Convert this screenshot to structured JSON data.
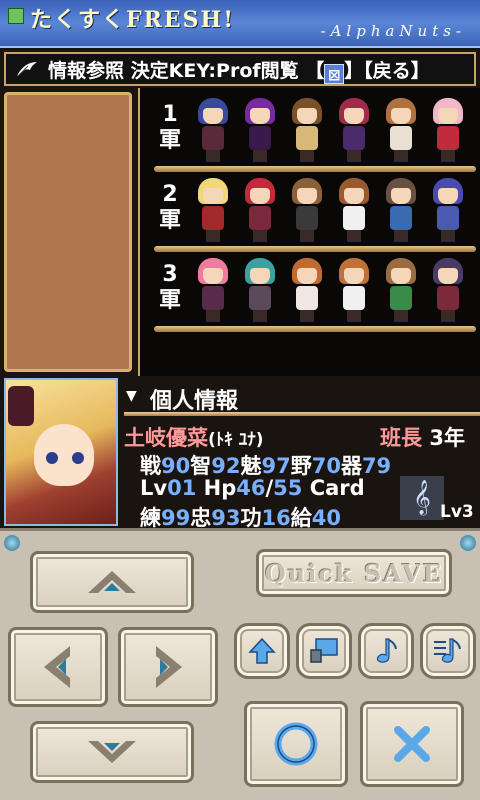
{
  "titlebar": {
    "title": "たくすくFRESH!",
    "subtitle": "-AlphaNuts-"
  },
  "header": {
    "text_prefix": "情報参照 決定KEY:Prof閲覧 【",
    "cancel_glyph": "⊠",
    "text_suffix": "】【戻る】"
  },
  "armies": [
    {
      "label": "1\n軍",
      "units": [
        {
          "hair": "#3a4a9a",
          "body": "#5a2a3a"
        },
        {
          "hair": "#7a2aa0",
          "body": "#3a1a4a"
        },
        {
          "hair": "#7a5028",
          "body": "#d8b878"
        },
        {
          "hair": "#a02a4a",
          "body": "#4a2a6a"
        },
        {
          "hair": "#b07040",
          "body": "#e8e0d0"
        },
        {
          "hair": "#f0b8c8",
          "body": "#c02a3a"
        }
      ]
    },
    {
      "label": "2\n軍",
      "units": [
        {
          "hair": "#f0d878",
          "body": "#a02a2a"
        },
        {
          "hair": "#c02a3a",
          "body": "#7a2a3a"
        },
        {
          "hair": "#8a6038",
          "body": "#3a3a3a"
        },
        {
          "hair": "#9a5a30",
          "body": "#f0f0f0"
        },
        {
          "hair": "#6a5040",
          "body": "#3a6ab0"
        },
        {
          "hair": "#4a4ab0",
          "body": "#4a5ab0"
        }
      ]
    },
    {
      "label": "3\n軍",
      "units": [
        {
          "hair": "#f07aa0",
          "body": "#5a2a4a"
        },
        {
          "hair": "#3aa0a0",
          "body": "#5a4a5a"
        },
        {
          "hair": "#c06a30",
          "body": "#f0e8e0"
        },
        {
          "hair": "#c07038",
          "body": "#f0f0f0"
        },
        {
          "hair": "#9a6a40",
          "body": "#3a8a4a"
        },
        {
          "hair": "#4a3a6a",
          "body": "#7a2a3a"
        }
      ]
    }
  ],
  "info": {
    "title": "個人情報",
    "name": "土岐優菜",
    "reading": "(ﾄｷ ﾕﾅ)",
    "role": "班長",
    "grade": "3",
    "grade_unit": "年",
    "stats1": [
      {
        "k": "戦",
        "v": "90"
      },
      {
        "k": "智",
        "v": "92"
      },
      {
        "k": "魅",
        "v": "97"
      },
      {
        "k": "野",
        "v": "70"
      },
      {
        "k": "器",
        "v": "79"
      }
    ],
    "lv_label": "Lv",
    "lv": "01",
    "hp_label": "Hp",
    "hp": "46",
    "hp_max": "55",
    "card_label": "Card",
    "stats3": [
      {
        "k": "練",
        "v": "99"
      },
      {
        "k": "忠",
        "v": "93"
      },
      {
        "k": "功",
        "v": "16"
      },
      {
        "k": "給",
        "v": "40"
      }
    ],
    "card_level": "Lv3"
  },
  "controls": {
    "quick_save": "Quick SAVE"
  }
}
